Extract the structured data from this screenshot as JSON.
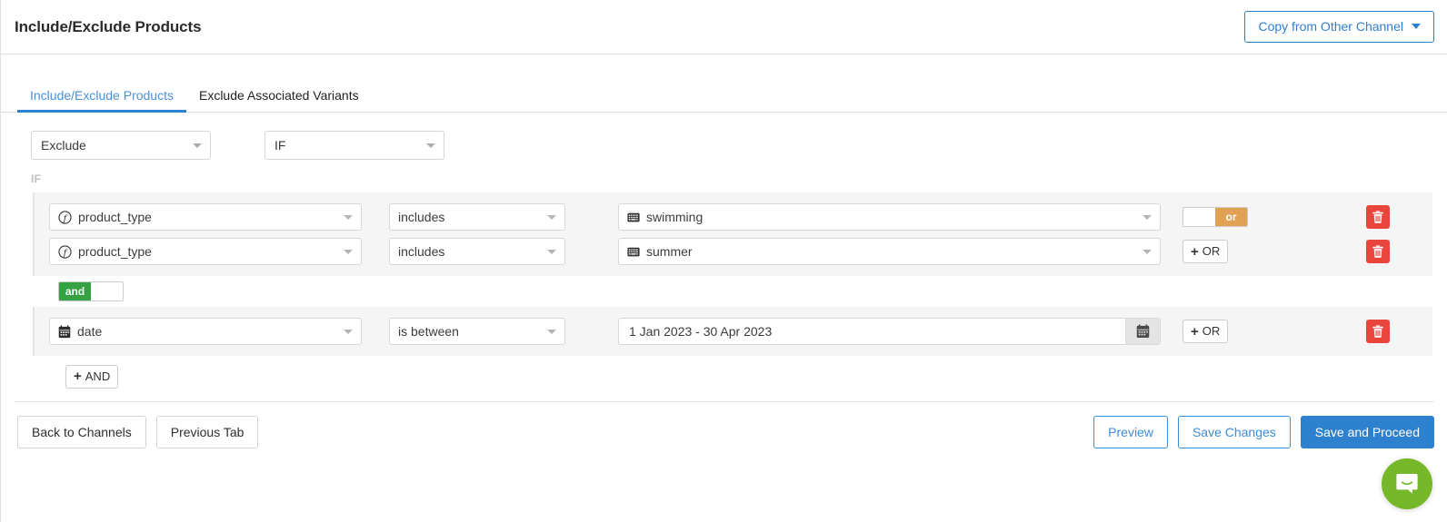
{
  "header": {
    "title": "Include/Exclude Products",
    "copy_button_label": "Copy from Other Channel"
  },
  "tabs": [
    {
      "label": "Include/Exclude Products",
      "active": true
    },
    {
      "label": "Exclude Associated Variants",
      "active": false
    }
  ],
  "top_selects": {
    "action": "Exclude",
    "condition_keyword": "IF"
  },
  "if_label": "IF",
  "conditions": [
    {
      "attribute": "product_type",
      "attribute_icon": "function-icon",
      "operator": "includes",
      "value": "swimming",
      "value_icon": "keyboard-icon",
      "connector_type": "toggle",
      "connector_label": "or",
      "connector_state": "on-right",
      "delete_icon": "trash-icon"
    },
    {
      "attribute": "product_type",
      "attribute_icon": "function-icon",
      "operator": "includes",
      "value": "summer",
      "value_icon": "keyboard-icon",
      "connector_type": "button",
      "connector_label": "OR",
      "delete_icon": "trash-icon"
    }
  ],
  "and_toggle": {
    "label": "and",
    "state": "on-left"
  },
  "date_condition": {
    "attribute": "date",
    "attribute_icon": "calendar-icon",
    "operator": "is between",
    "value": "1 Jan 2023 - 30 Apr 2023",
    "picker_icon": "calendar-icon",
    "connector_type": "button",
    "connector_label": "OR",
    "delete_icon": "trash-icon"
  },
  "add_and_button": {
    "label": "AND",
    "plus": "+"
  },
  "add_or_plus": "+",
  "footer": {
    "back_to_channels": "Back to Channels",
    "previous_tab": "Previous Tab",
    "preview": "Preview",
    "save_changes": "Save Changes",
    "save_and_proceed": "Save and Proceed"
  },
  "chat": {
    "icon": "chat-bubble-icon"
  },
  "colors": {
    "primary": "#2d81cf",
    "tab_active": "#4a90d9",
    "or_orange": "#e0a155",
    "and_green": "#34a142",
    "delete_red": "#e8453c",
    "chat_green": "#77b82a"
  }
}
